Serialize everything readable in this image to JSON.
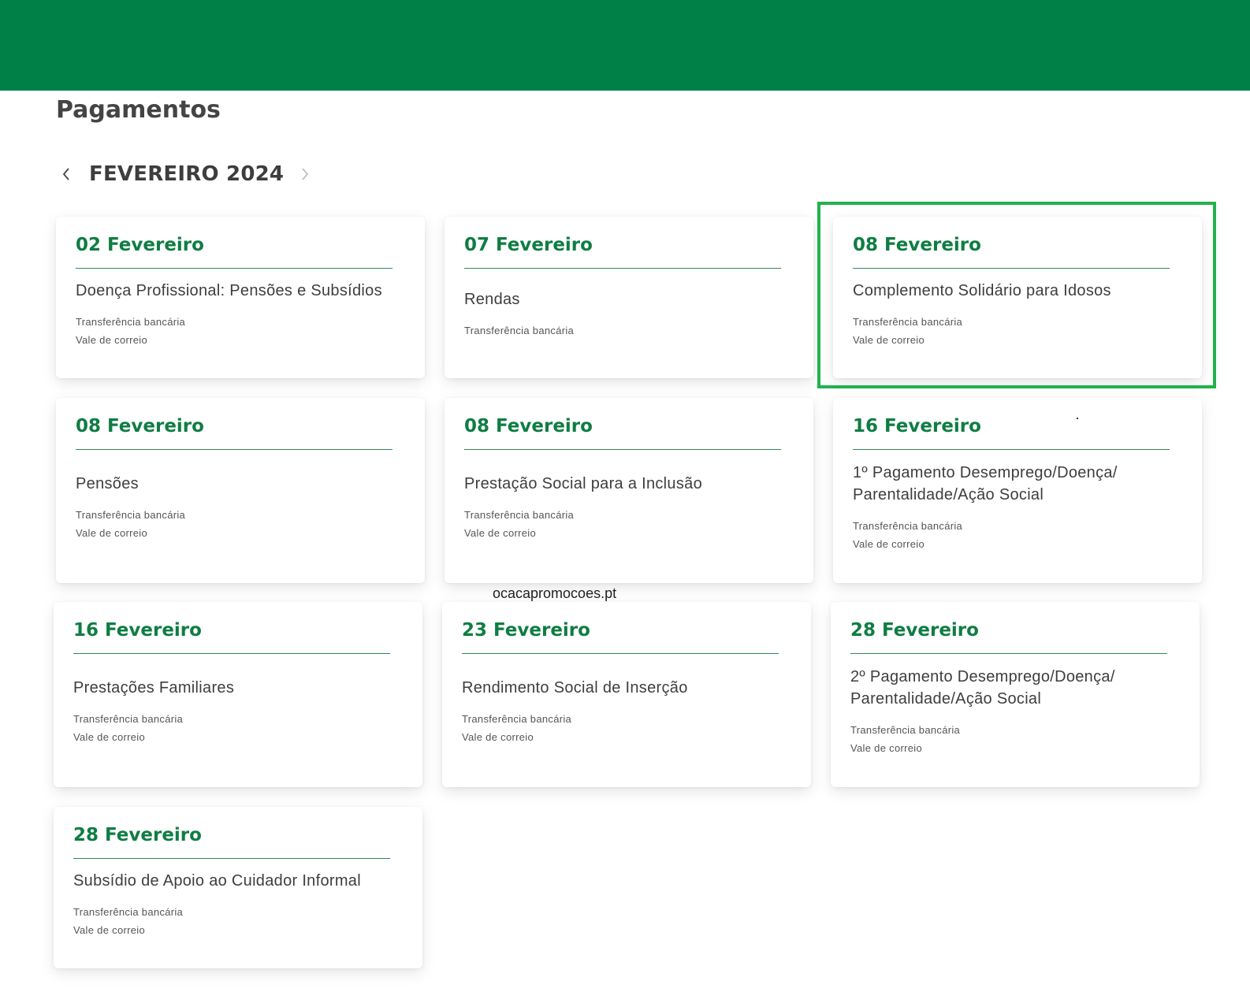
{
  "page": {
    "title": "Pagamentos",
    "month": "FEVEREIRO 2024",
    "watermark": "ocacapromocoes.pt",
    "accent_color": "#008047",
    "date_color": "#0f7d43",
    "highlight_color": "#22b24c"
  },
  "icons": {
    "prev": "chevron-left-icon",
    "next": "chevron-right-icon"
  },
  "payments": [
    {
      "date": "02 Fevereiro",
      "title": "Doença Profissional: Pensões e Subsídios",
      "methods": [
        "Transferência bancária",
        "Vale de correio"
      ]
    },
    {
      "date": "07 Fevereiro",
      "title": "Rendas",
      "methods": [
        "Transferência bancária"
      ]
    },
    {
      "date": "08 Fevereiro",
      "title": "Complemento Solidário para Idosos",
      "methods": [
        "Transferência bancária",
        "Vale de correio"
      ],
      "highlighted": true
    },
    {
      "date": "08 Fevereiro",
      "title": "Pensões",
      "methods": [
        "Transferência bancária",
        "Vale de correio"
      ]
    },
    {
      "date": "08 Fevereiro",
      "title": "Prestação Social para a Inclusão",
      "methods": [
        "Transferência bancária",
        "Vale de correio"
      ]
    },
    {
      "date": "16 Fevereiro",
      "title_lines": [
        "1º Pagamento Desemprego/Doença/",
        "Parentalidade/Ação Social"
      ],
      "methods": [
        "Transferência bancária",
        "Vale de correio"
      ]
    },
    {
      "date": "16 Fevereiro",
      "title": "Prestações Familiares",
      "methods": [
        "Transferência bancária",
        "Vale de correio"
      ]
    },
    {
      "date": "23 Fevereiro",
      "title": "Rendimento Social de Inserção",
      "methods": [
        "Transferência bancária",
        "Vale de correio"
      ]
    },
    {
      "date": "28 Fevereiro",
      "title_lines": [
        "2º Pagamento Desemprego/Doença/",
        "Parentalidade/Ação Social"
      ],
      "methods": [
        "Transferência bancária",
        "Vale de correio"
      ]
    },
    {
      "date": "28 Fevereiro",
      "title": "Subsídio de Apoio ao Cuidador Informal",
      "methods": [
        "Transferência bancária",
        "Vale de correio"
      ]
    }
  ]
}
